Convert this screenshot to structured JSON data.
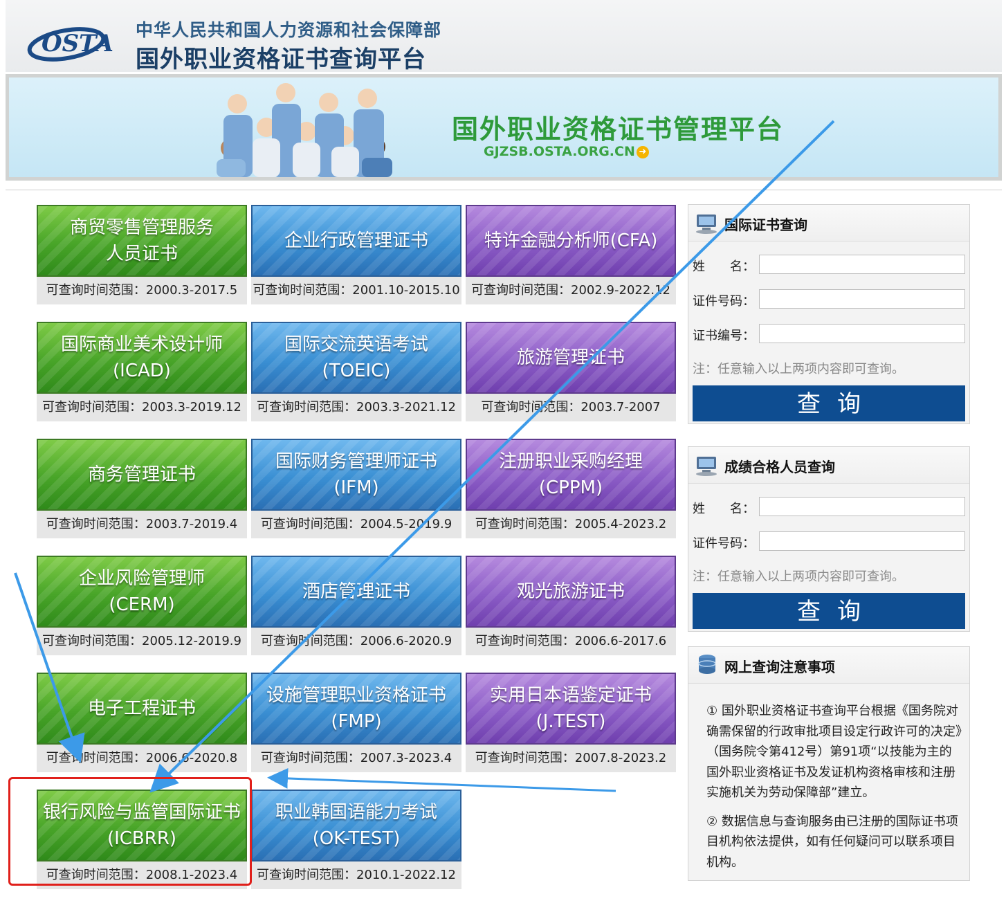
{
  "header": {
    "logo_text": "OSTA",
    "org_name": "中华人民共和国人力资源和社会保障部",
    "platform_title": "国外职业资格证书查询平台"
  },
  "banner": {
    "title": "国外职业资格证书管理平台",
    "url": "GJZSB.OSTA.ORG.CN"
  },
  "range_prefix": "可查询时间范围：",
  "tiles": [
    {
      "line1": "商贸零售管理服务",
      "line2": "人员证书",
      "range": "可查询时间范围：2000.3-2017.5",
      "color": "green"
    },
    {
      "line1": "企业行政管理证书",
      "line2": "",
      "range": "可查询时间范围：2001.10-2015.10",
      "color": "blue"
    },
    {
      "line1": "特许金融分析师(CFA)",
      "line2": "",
      "range": "可查询时间范围：2002.9-2022.12",
      "color": "purple"
    },
    {
      "line1": "国际商业美术设计师",
      "line2": "(ICAD)",
      "range": "可查询时间范围：2003.3-2019.12",
      "color": "green"
    },
    {
      "line1": "国际交流英语考试",
      "line2": "(TOEIC)",
      "range": "可查询时间范围：2003.3-2021.12",
      "color": "blue"
    },
    {
      "line1": "旅游管理证书",
      "line2": "",
      "range": "可查询时间范围：2003.7-2007",
      "color": "purple"
    },
    {
      "line1": "商务管理证书",
      "line2": "",
      "range": "可查询时间范围：2003.7-2019.4",
      "color": "green"
    },
    {
      "line1": "国际财务管理师证书",
      "line2": "(IFM)",
      "range": "可查询时间范围：2004.5-2019.9",
      "color": "blue"
    },
    {
      "line1": "注册职业采购经理",
      "line2": "(CPPM)",
      "range": "可查询时间范围：2005.4-2023.2",
      "color": "purple"
    },
    {
      "line1": "企业风险管理师",
      "line2": "(CERM)",
      "range": "可查询时间范围：2005.12-2019.9",
      "color": "green"
    },
    {
      "line1": "酒店管理证书",
      "line2": "",
      "range": "可查询时间范围：2006.6-2020.9",
      "color": "blue"
    },
    {
      "line1": "观光旅游证书",
      "line2": "",
      "range": "可查询时间范围：2006.6-2017.6",
      "color": "purple"
    },
    {
      "line1": "电子工程证书",
      "line2": "",
      "range": "可查询时间范围：2006.6-2020.8",
      "color": "green"
    },
    {
      "line1": "设施管理职业资格证书",
      "line2": "(FMP)",
      "range": "可查询时间范围：2007.3-2023.4",
      "color": "blue"
    },
    {
      "line1": "实用日本语鉴定证书",
      "line2": "(J.TEST)",
      "range": "可查询时间范围：2007.8-2023.2",
      "color": "purple"
    },
    {
      "line1": "银行风险与监管国际证书",
      "line2": "(ICBRR)",
      "range": "可查询时间范围：2008.1-2023.4",
      "color": "green"
    },
    {
      "line1": "职业韩国语能力考试",
      "line2": "(OK-TEST)",
      "range": "可查询时间范围：2010.1-2022.12",
      "color": "blue"
    }
  ],
  "cert_query": {
    "title": "国际证书查询",
    "name_label": "姓　　名：",
    "id_label": "证件号码：",
    "cert_no_label": "证书编号：",
    "name_value": "",
    "id_value": "",
    "cert_no_value": "",
    "note": "注：任意输入以上两项内容即可查询。",
    "button": "查询"
  },
  "score_query": {
    "title": "成绩合格人员查询",
    "name_label": "姓　　名：",
    "id_label": "证件号码：",
    "name_value": "",
    "id_value": "",
    "note": "注：任意输入以上两项内容即可查询。",
    "button": "查询"
  },
  "notice": {
    "title": "网上查询注意事项",
    "p1": "① 国外职业资格证书查询平台根据《国务院对确需保留的行政审批项目设定行政许可的决定》（国务院令第412号）第91项“以技能为主的国外职业资格证书及发证机构资格审核和注册实施机关为劳动保障部”建立。",
    "p2": "② 数据信息与查询服务由已注册的国际证书项目机构依法提供，如有任何疑问可以联系项目机构。"
  },
  "colors": {
    "accent_blue": "#0e4d91",
    "tile_green": "#48a428",
    "tile_blue": "#3a8fd3",
    "tile_purple": "#8b5cc6",
    "annotation_red": "#e0201b",
    "annotation_arrow": "#3c9ae8"
  }
}
